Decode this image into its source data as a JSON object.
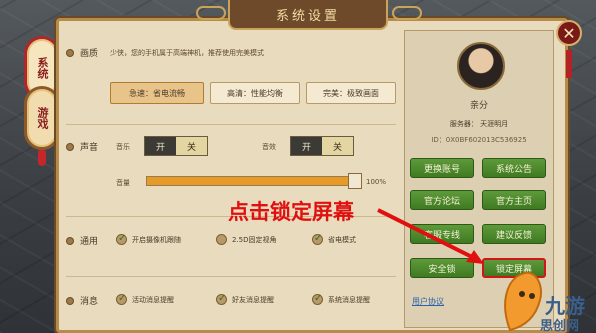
{
  "side_tabs": [
    {
      "label": "系统",
      "active": true
    },
    {
      "label": "游戏",
      "active": false
    }
  ],
  "panel": {
    "title": "系统设置"
  },
  "close_label": "✕",
  "quality": {
    "label": "画质",
    "hint": "少侠，您的手机属于高端神机，推荐使用完美模式",
    "options": [
      "急速：省电流畅",
      "高清：性能均衡",
      "完美：极致画面"
    ],
    "selected": "急速：省电流畅"
  },
  "sound": {
    "label": "声音",
    "music_label": "音乐",
    "effects_label": "音效",
    "on": "开",
    "off": "关",
    "volume_label": "音量",
    "volume_value": "100%",
    "volume_level": 0.97
  },
  "general": {
    "label": "通用",
    "options": [
      {
        "label": "开启摄像机跟随",
        "checked": true
      },
      {
        "label": "2.5D固定视角",
        "checked": false
      },
      {
        "label": "省电模式",
        "checked": true
      }
    ]
  },
  "messages": {
    "label": "消息",
    "options": [
      {
        "label": "活动消息提醒",
        "checked": true
      },
      {
        "label": "好友消息提醒",
        "checked": true
      },
      {
        "label": "系统消息提醒",
        "checked": true
      }
    ]
  },
  "profile": {
    "name": "亲分",
    "server": "服务器： 天涯明月",
    "id": "ID：0X0BF602013C536925",
    "buttons": [
      "更换账号",
      "系统公告",
      "官方论坛",
      "官方主页",
      "客服专线",
      "建议反馈",
      "安全锁",
      "锁定屏幕"
    ],
    "user_agreement": "用户协议"
  },
  "annotation": {
    "text": "点击锁定屏幕",
    "color": "#e01010"
  },
  "watermark": {
    "line1": "九游",
    "line2": "思创网"
  }
}
